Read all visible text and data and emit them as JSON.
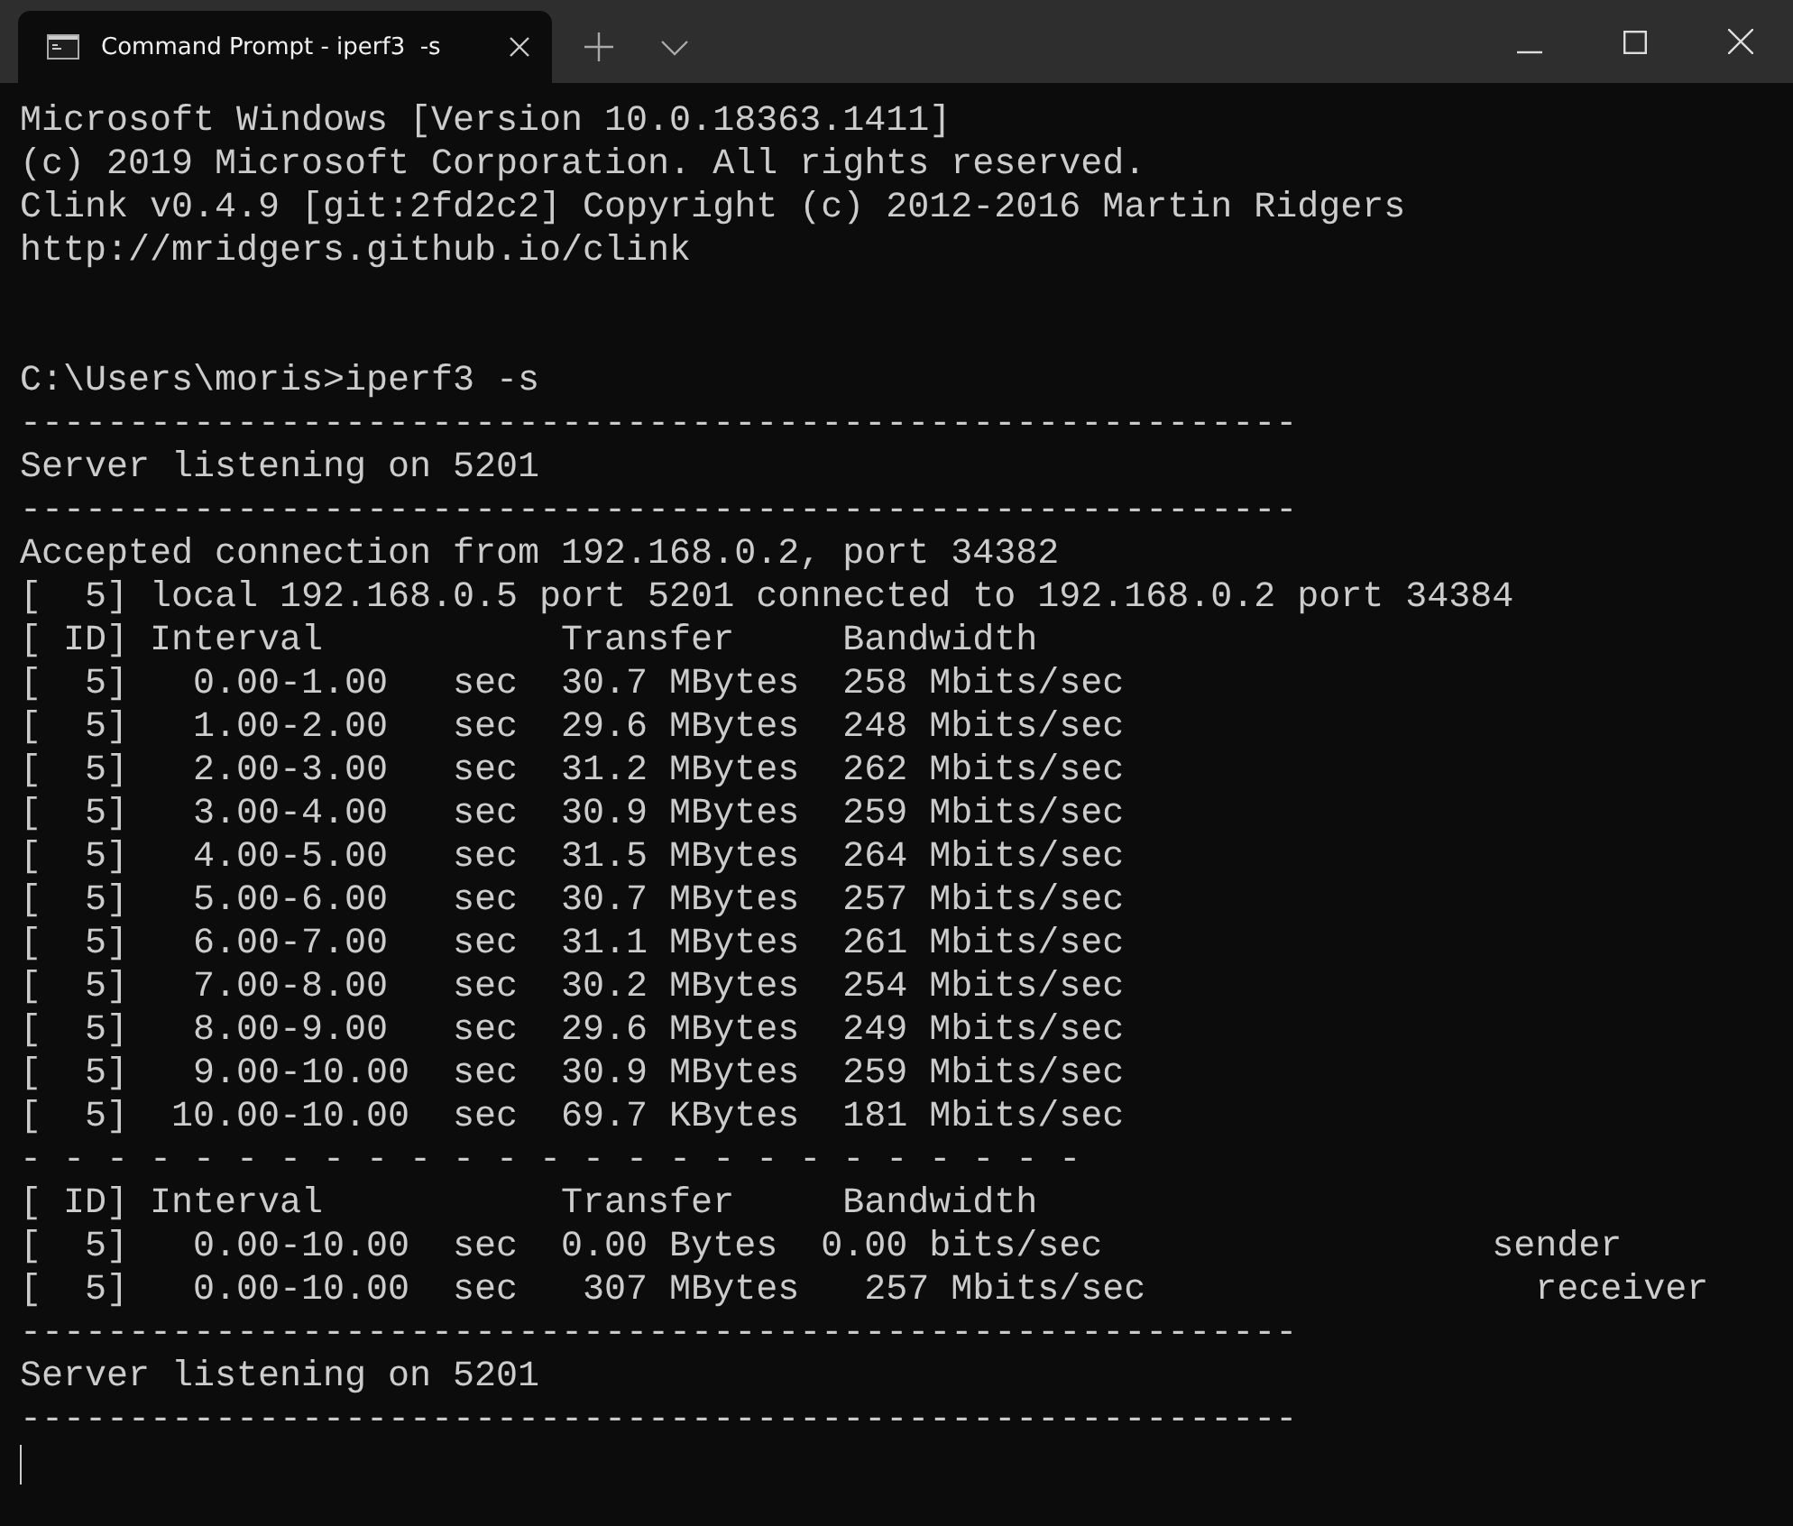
{
  "window": {
    "tab_title": "Command Prompt - iperf3  -s"
  },
  "terminal": {
    "blocks": [
      {
        "lines": [
          "Microsoft Windows [Version 10.0.18363.1411]",
          "(c) 2019 Microsoft Corporation. All rights reserved.",
          "Clink v0.4.9 [git:2fd2c2] Copyright (c) 2012-2016 Martin Ridgers",
          "http://mridgers.github.io/clink"
        ]
      },
      {
        "lines": [
          "C:\\Users\\moris>iperf3 -s",
          "-----------------------------------------------------------",
          "Server listening on 5201",
          "-----------------------------------------------------------",
          "Accepted connection from 192.168.0.2, port 34382",
          "[  5] local 192.168.0.5 port 5201 connected to 192.168.0.2 port 34384",
          "[ ID] Interval           Transfer     Bandwidth",
          "[  5]   0.00-1.00   sec  30.7 MBytes  258 Mbits/sec",
          "[  5]   1.00-2.00   sec  29.6 MBytes  248 Mbits/sec",
          "[  5]   2.00-3.00   sec  31.2 MBytes  262 Mbits/sec",
          "[  5]   3.00-4.00   sec  30.9 MBytes  259 Mbits/sec",
          "[  5]   4.00-5.00   sec  31.5 MBytes  264 Mbits/sec",
          "[  5]   5.00-6.00   sec  30.7 MBytes  257 Mbits/sec",
          "[  5]   6.00-7.00   sec  31.1 MBytes  261 Mbits/sec",
          "[  5]   7.00-8.00   sec  30.2 MBytes  254 Mbits/sec",
          "[  5]   8.00-9.00   sec  29.6 MBytes  249 Mbits/sec",
          "[  5]   9.00-10.00  sec  30.9 MBytes  259 Mbits/sec",
          "[  5]  10.00-10.00  sec  69.7 KBytes  181 Mbits/sec",
          "- - - - - - - - - - - - - - - - - - - - - - - - -",
          "[ ID] Interval           Transfer     Bandwidth",
          "[  5]   0.00-10.00  sec  0.00 Bytes  0.00 bits/sec                  sender",
          "[  5]   0.00-10.00  sec   307 MBytes   257 Mbits/sec                  receiver",
          "-----------------------------------------------------------",
          "Server listening on 5201",
          "-----------------------------------------------------------"
        ]
      }
    ],
    "cursor": true
  }
}
